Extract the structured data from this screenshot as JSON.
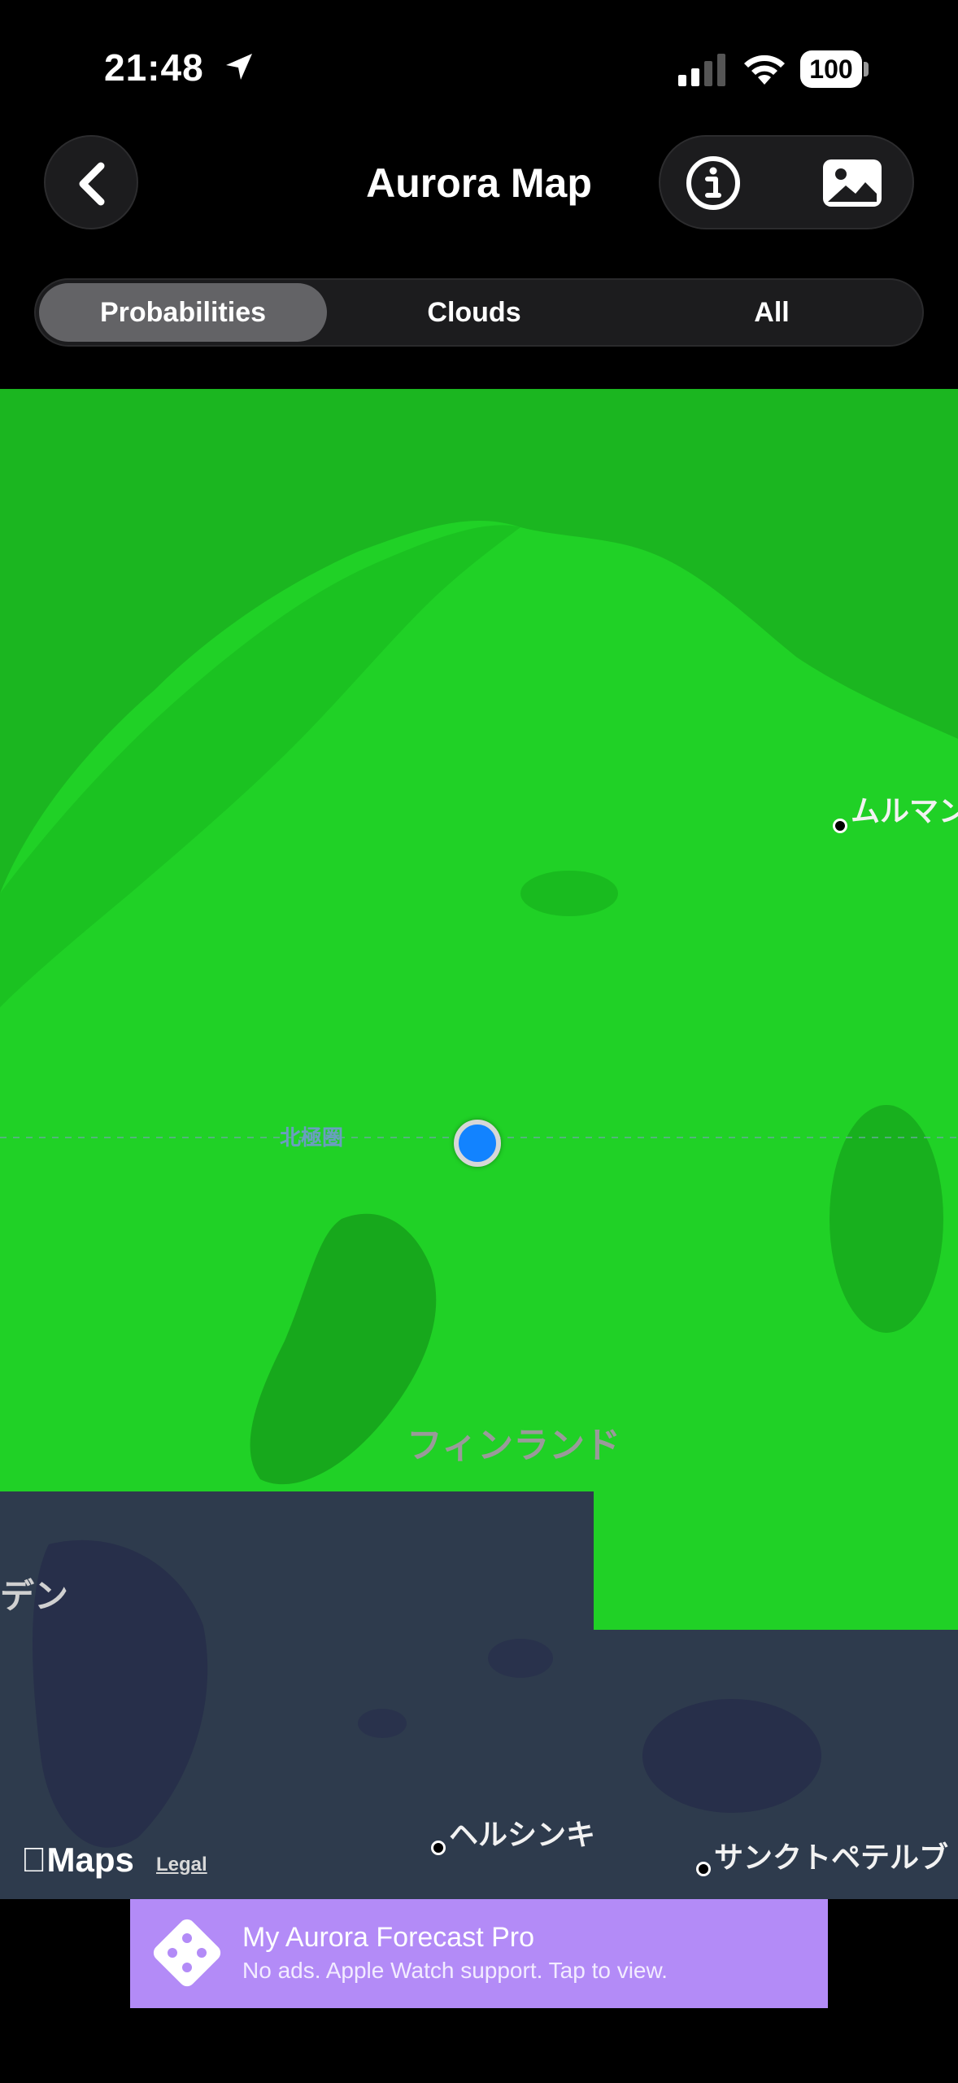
{
  "status_bar": {
    "time": "21:48",
    "battery": "100"
  },
  "header": {
    "title": "Aurora Map"
  },
  "segments": [
    {
      "label": "Probabilities",
      "selected": true
    },
    {
      "label": "Clouds",
      "selected": false
    },
    {
      "label": "All",
      "selected": false
    }
  ],
  "map": {
    "labels": {
      "arctic_circle": "北極圏",
      "finland": "フィンランド",
      "murmansk": "ムルマン",
      "sweden_partial": "デン",
      "helsinki": "ヘルシンキ",
      "st_petersburg": "サンクトペテルブ"
    },
    "colors": {
      "probability_high": "#1fd325",
      "low_overlay": "#2f3a4c"
    },
    "attribution": {
      "maps": "Maps",
      "legal": "Legal"
    }
  },
  "ad": {
    "title": "My Aurora Forecast Pro",
    "subtitle": "No ads. Apple Watch support. Tap to view.",
    "color": "#b38bf7"
  },
  "icons": [
    "location-arrow-icon",
    "cellular-signal-icon",
    "wifi-icon",
    "battery-icon",
    "chevron-left-icon",
    "info-icon",
    "photo-icon",
    "dice-icon"
  ]
}
